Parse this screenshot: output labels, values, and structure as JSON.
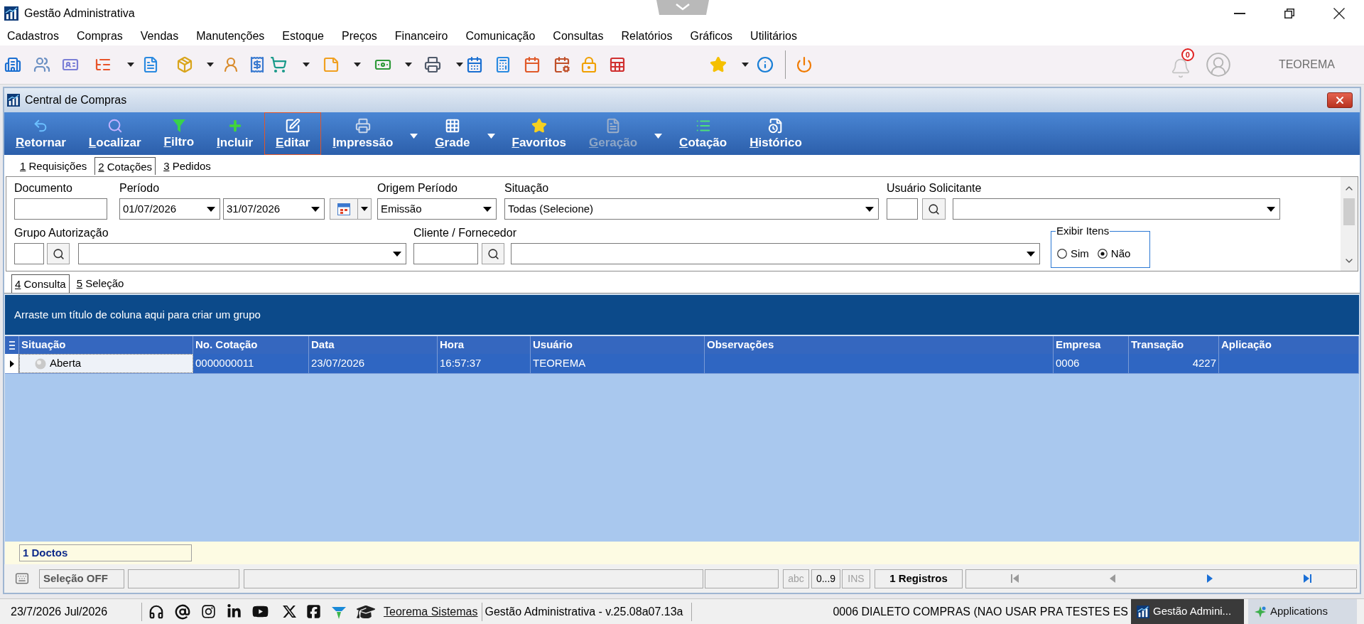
{
  "app": {
    "title": "Gestão Administrativa"
  },
  "menu": [
    "Cadastros",
    "Compras",
    "Vendas",
    "Manutenções",
    "Estoque",
    "Preços",
    "Financeiro",
    "Comunicação",
    "Consultas",
    "Relatórios",
    "Gráficos",
    "Utilitários"
  ],
  "toolbar": {
    "notification_count": "0",
    "user": "TEOREMA"
  },
  "window": {
    "title": "Central de Compras",
    "actions": [
      {
        "label": "Retornar",
        "highlighted": false,
        "disabled": false,
        "dropdown": false
      },
      {
        "label": "Localizar",
        "highlighted": false,
        "disabled": false,
        "dropdown": false
      },
      {
        "label": "Filtro",
        "highlighted": false,
        "disabled": false,
        "dropdown": false
      },
      {
        "label": "Incluir",
        "highlighted": false,
        "disabled": false,
        "dropdown": false
      },
      {
        "label": "Editar",
        "highlighted": true,
        "disabled": false,
        "dropdown": false
      },
      {
        "label": "Impressão",
        "highlighted": false,
        "disabled": false,
        "dropdown": true
      },
      {
        "label": "Grade",
        "highlighted": false,
        "disabled": false,
        "dropdown": true
      },
      {
        "label": "Favoritos",
        "highlighted": false,
        "disabled": false,
        "dropdown": false
      },
      {
        "label": "Geração",
        "highlighted": false,
        "disabled": true,
        "dropdown": true
      },
      {
        "label": "Cotação",
        "highlighted": false,
        "disabled": false,
        "dropdown": false
      },
      {
        "label": "Histórico",
        "highlighted": false,
        "disabled": false,
        "dropdown": false
      }
    ],
    "tabs": [
      {
        "label": "1 Requisições",
        "selected": false
      },
      {
        "label": "2 Cotações",
        "selected": true
      },
      {
        "label": "3 Pedidos",
        "selected": false
      }
    ],
    "filters": {
      "document": {
        "label": "Documento"
      },
      "period": {
        "label": "Período",
        "from": "01/07/2026",
        "to": "31/07/2026"
      },
      "period_origin": {
        "label": "Origem Período",
        "value": "Emissão"
      },
      "status": {
        "label": "Situação",
        "value": "Todas (Selecione)"
      },
      "requesting_user": {
        "label": "Usuário Solicitante"
      },
      "authorization_group": {
        "label": "Grupo Autorização"
      },
      "customer_supplier": {
        "label": "Cliente / Fornecedor"
      },
      "show_items": {
        "label": "Exibir Itens",
        "options": [
          {
            "label": "Sim",
            "selected": false
          },
          {
            "label": "Não",
            "selected": true
          }
        ]
      }
    },
    "subtabs": [
      {
        "label": "4 Consulta",
        "selected": true
      },
      {
        "label": "5 Seleção",
        "selected": false
      }
    ],
    "group_hint": "Arraste um título de coluna aqui para criar um grupo",
    "table": {
      "columns": [
        "Situação",
        "No. Cotação",
        "Data",
        "Hora",
        "Usuário",
        "Observações",
        "Empresa",
        "Transação",
        "Aplicação"
      ],
      "rows": [
        {
          "selected": true,
          "status": "Aberta",
          "quote_no": "0000000011",
          "date": "23/07/2026",
          "time": "16:57:37",
          "user": "TEOREMA",
          "company": "0006",
          "transaction": "4227"
        }
      ]
    },
    "summary": "1 Doctos",
    "status_bar": {
      "selection": "Seleção OFF",
      "indicators": [
        {
          "label": "abc",
          "on": false
        },
        {
          "label": "0...9",
          "on": true
        },
        {
          "label": "INS",
          "on": false
        }
      ],
      "records": "1 Registros",
      "navigation": [
        {
          "kind": "first",
          "disabled": true
        },
        {
          "kind": "previous",
          "disabled": true
        },
        {
          "kind": "next",
          "disabled": false
        },
        {
          "kind": "last",
          "disabled": false
        }
      ]
    }
  },
  "taskbar": {
    "date": "23/7/2026 Jul/2026",
    "link": "Teorema Sistemas",
    "version": "Gestão Administrativa - v.25.08a07.13a",
    "company": "0006 DIALETO COMPRAS (NAO USAR PRA TESTES ES",
    "windows": [
      {
        "label": "Gestão Admini...",
        "selected": true
      },
      {
        "label": "Applications",
        "selected": false
      }
    ]
  }
}
